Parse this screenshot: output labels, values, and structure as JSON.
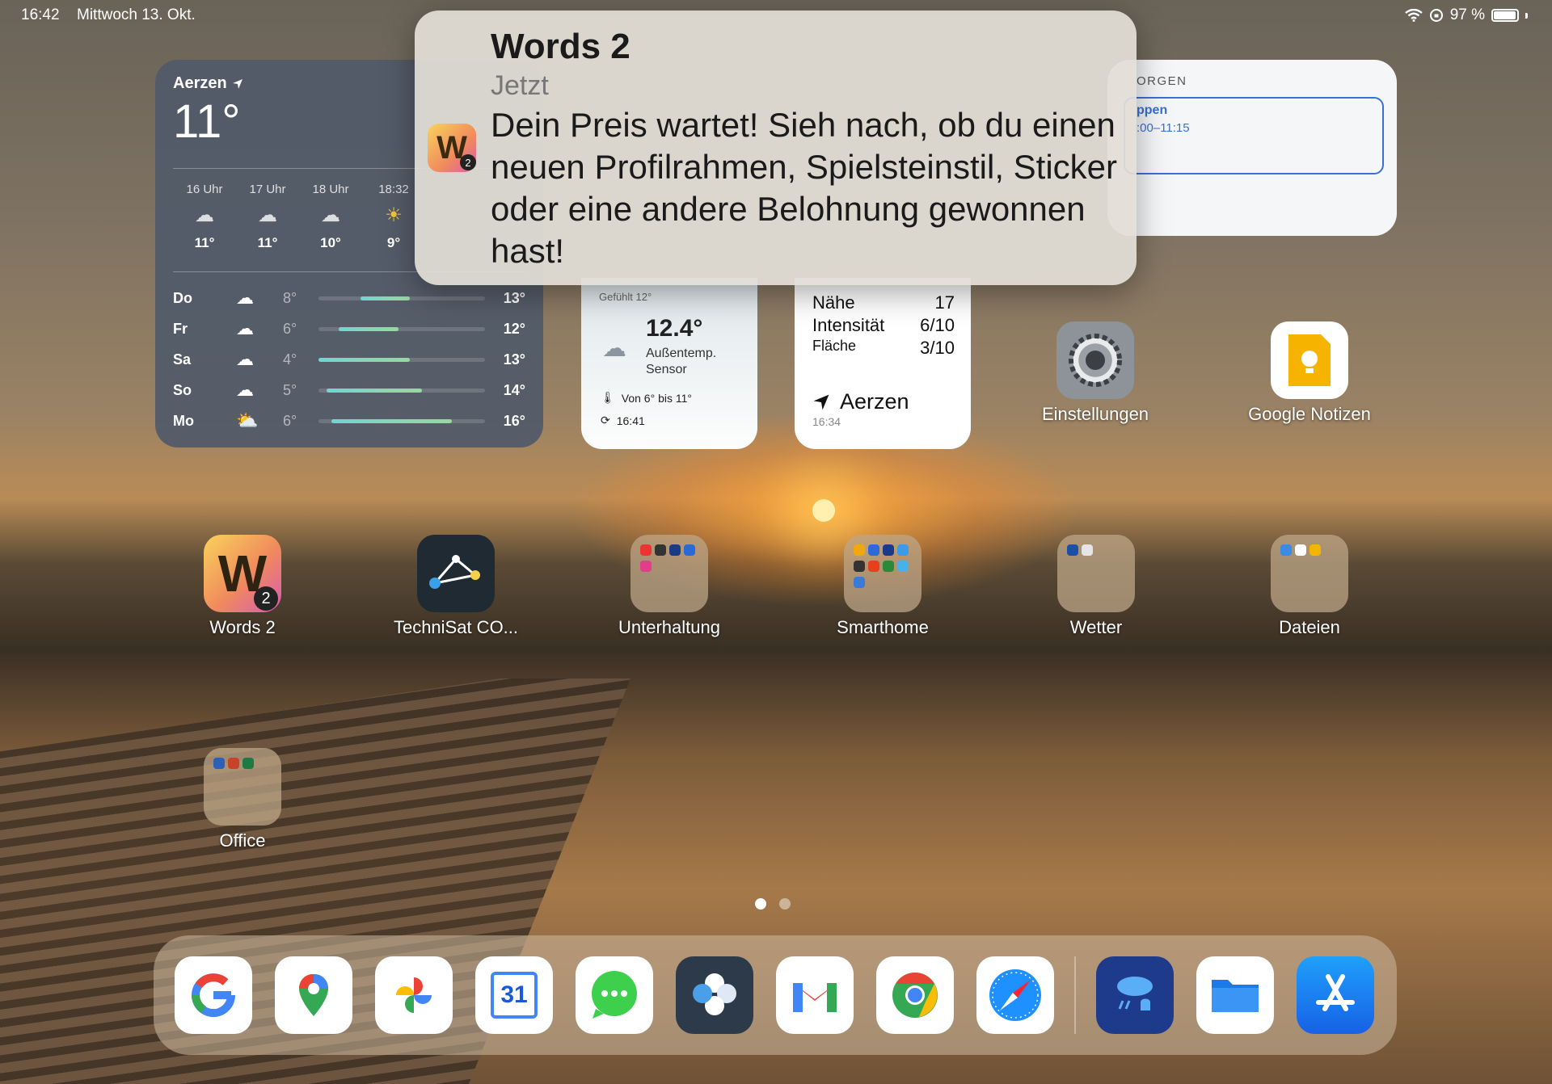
{
  "status": {
    "time": "16:42",
    "date": "Mittwoch 13. Okt.",
    "battery": "97 %"
  },
  "weather": {
    "city": "Aerzen",
    "temp": "11°",
    "hours": [
      {
        "label": "16 Uhr",
        "temp": "11°",
        "icon": "rain-cloud-icon"
      },
      {
        "label": "17 Uhr",
        "temp": "11°",
        "icon": "rain-cloud-icon"
      },
      {
        "label": "18 Uhr",
        "temp": "10°",
        "icon": "rain-cloud-icon"
      },
      {
        "label": "18:32",
        "temp": "9°",
        "icon": "sunset-icon"
      }
    ],
    "days": [
      {
        "name": "Do",
        "low": "8°",
        "high": "13°",
        "bar_start": 0.25,
        "bar_end": 0.55,
        "icon": "rain-cloud-icon"
      },
      {
        "name": "Fr",
        "low": "6°",
        "high": "12°",
        "bar_start": 0.12,
        "bar_end": 0.48,
        "icon": "rain-cloud-icon"
      },
      {
        "name": "Sa",
        "low": "4°",
        "high": "13°",
        "bar_start": 0.0,
        "bar_end": 0.55,
        "icon": "cloud-icon"
      },
      {
        "name": "So",
        "low": "5°",
        "high": "14°",
        "bar_start": 0.05,
        "bar_end": 0.62,
        "icon": "cloud-icon"
      },
      {
        "name": "Mo",
        "low": "6°",
        "high": "16°",
        "bar_start": 0.08,
        "bar_end": 0.8,
        "icon": "partly-sunny-icon"
      }
    ]
  },
  "calendar": {
    "header": "ORGEN",
    "event_title": "ppen",
    "event_time": ":00–11:15"
  },
  "notification": {
    "app": "Words 2",
    "time": "Jetzt",
    "body": "Dein Preis wartet! Sieh nach, ob du einen neuen Profilrahmen, Spielsteinstil, Sticker oder eine andere Belohnung gewonnen hast!",
    "badge": "2"
  },
  "sensor": {
    "felt": "Gefühlt 12°",
    "temp": "12.4°",
    "label1": "Außentemp.",
    "label2": "Sensor",
    "range": "Von 6° bis 11°",
    "updated": "16:41"
  },
  "pollen": {
    "rows": [
      {
        "label": "Nähe",
        "value": "17"
      },
      {
        "label": "Intensität",
        "value": "6/10"
      },
      {
        "label": "Fläche",
        "value": "3/10"
      }
    ],
    "location": "Aerzen",
    "time": "16:34"
  },
  "apps": {
    "einstellungen": "Einstellungen",
    "google_notizen": "Google Notizen",
    "words": "Words 2",
    "words_badge": "2",
    "technisat": "TechniSat CO...",
    "unterhaltung": "Unterhaltung",
    "smarthome": "Smarthome",
    "wetter": "Wetter",
    "dateien": "Dateien",
    "office": "Office"
  },
  "dock": {
    "calendar_day": "31"
  },
  "colors": {
    "accent_blue": "#3a6fd8",
    "weather_bg": "#505a69",
    "notification_bg": "#e2ded6"
  }
}
